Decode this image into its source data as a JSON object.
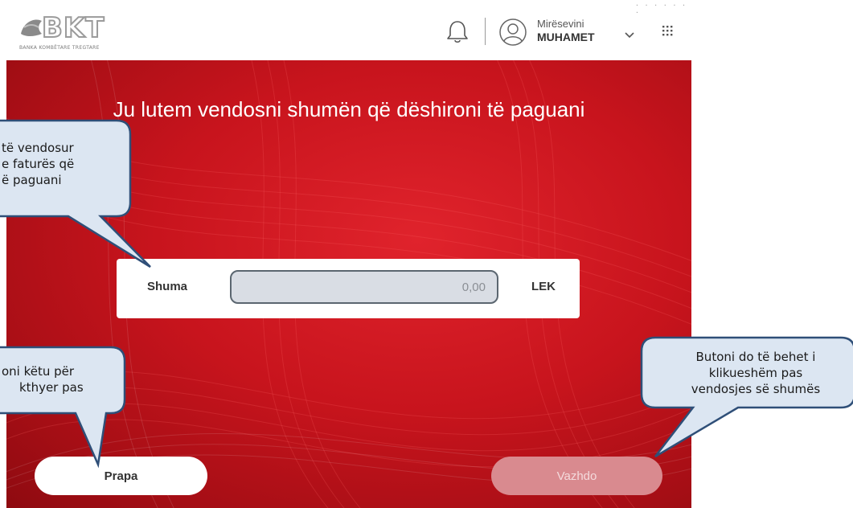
{
  "header": {
    "logo_text": "BKT",
    "logo_subtitle": "BANKA KOMBËTARE TREGTARE",
    "greeting": "Mirësevini",
    "user_name": "MUHAMET"
  },
  "main": {
    "title": "Ju lutem vendosni shumën që dëshironi të paguani",
    "amount_label": "Shuma",
    "amount_value": "0,00",
    "currency": "LEK",
    "back_button": "Prapa",
    "next_button": "Vazhdo"
  },
  "callouts": {
    "amount_hint": [
      "të vendosur",
      "e faturës që",
      "ë paguani"
    ],
    "back_hint": [
      "oni këtu për",
      "kthyer pas"
    ],
    "next_hint": [
      "Butoni do të behet i",
      "klikueshëm pas",
      "vendosjes së shumës"
    ]
  },
  "colors": {
    "brand_red": "#c8141d",
    "callout_fill": "#dce6f2",
    "callout_border": "#2f4f78",
    "disabled_button": "#d98a8f"
  },
  "icons": [
    "bell-icon",
    "user-avatar-icon",
    "chevron-down-icon",
    "apps-grid-icon"
  ]
}
